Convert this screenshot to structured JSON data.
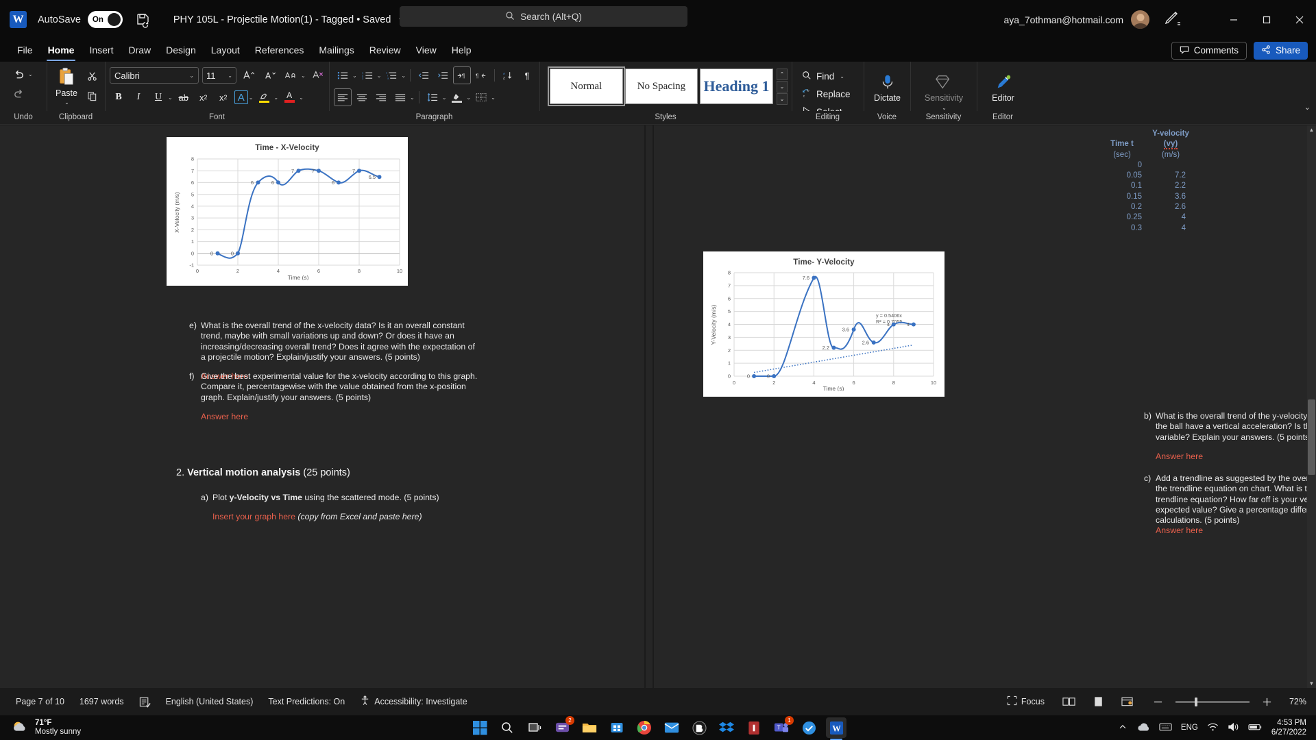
{
  "titlebar": {
    "app_logo": "W",
    "autosave_label": "AutoSave",
    "autosave_state": "On",
    "document_title": "PHY 105L - Projectile Motion(1) - Tagged • Saved",
    "search_placeholder": "Search (Alt+Q)",
    "account_email": "aya_7othman@hotmail.com"
  },
  "menu": {
    "tabs": [
      "File",
      "Home",
      "Insert",
      "Draw",
      "Design",
      "Layout",
      "References",
      "Mailings",
      "Review",
      "View",
      "Help"
    ],
    "active_tab": "Home",
    "comments_label": "Comments",
    "share_label": "Share"
  },
  "ribbon": {
    "groups": [
      "Undo",
      "Clipboard",
      "Font",
      "Paragraph",
      "Styles",
      "Editing",
      "Voice",
      "Sensitivity",
      "Editor"
    ],
    "paste_label": "Paste",
    "font_name": "Calibri",
    "font_size": "11",
    "styles": [
      {
        "label": "Normal",
        "kind": "normal",
        "selected": true
      },
      {
        "label": "No Spacing",
        "kind": "normal",
        "selected": false
      },
      {
        "label": "Heading 1",
        "kind": "h1",
        "selected": false
      }
    ],
    "editing": {
      "find_label": "Find",
      "replace_label": "Replace",
      "select_label": "Select"
    },
    "dictate_label": "Dictate",
    "sensitivity_label": "Sensitivity",
    "editor_label": "Editor"
  },
  "document": {
    "left_column": {
      "questions": [
        {
          "marker": "e)",
          "text": "What is the overall trend of the x-velocity data?  Is it an overall constant trend, maybe with small variations up and down? Or does it have an increasing/decreasing overall trend? Does it agree with the expectation of a projectile motion? Explain/justify your answers. (5 points)",
          "answer": "Answer here"
        },
        {
          "marker": "f)",
          "text": "Give the best experimental value for the x-velocity according to this graph.  Compare it, percentagewise with the value obtained from the x-position graph. Explain/justify your answers. (5 points)",
          "answer": "Answer here"
        }
      ],
      "section_number": "2.",
      "section_title": "Vertical motion analysis",
      "section_points": "(25 points)",
      "sub_a_marker": "a)",
      "sub_a_pre": "Plot ",
      "sub_a_bold": "y-Velocity vs Time",
      "sub_a_post": " using the scattered mode. (5 points)",
      "insert_graph_label": "Insert your graph here",
      "insert_graph_hint": "(copy from Excel and paste here)"
    },
    "right_column": {
      "table": {
        "header_col1_line1": "Time t",
        "header_col1_line2": "(sec)",
        "header_col2_line1": "Y-velocity",
        "header_col2_line2": "(vy)",
        "header_col2_line3": "(m/s)",
        "rows": [
          {
            "t": "0",
            "vy": ""
          },
          {
            "t": "0.05",
            "vy": "7.2"
          },
          {
            "t": "0.1",
            "vy": "2.2"
          },
          {
            "t": "0.15",
            "vy": "3.6"
          },
          {
            "t": "0.2",
            "vy": "2.6"
          },
          {
            "t": "0.25",
            "vy": "4"
          },
          {
            "t": "0.3",
            "vy": "4"
          }
        ]
      },
      "questions": [
        {
          "marker": "b)",
          "text": "What is the overall trend of the y-velocity data? Based on this graph, does the ball have a vertical acceleration? Is the acceleration constant or variable? Explain your answers. (5 points)",
          "answer": "Answer here"
        },
        {
          "marker": "c)",
          "text": "Add a trendline as suggested by the overall trend of the data points. Show the trendline equation on chart.  What is the y-acceleration as read off the trendline equation? How far off is your vertical acceleration from the expected value? Give a percentage difference. Explain your answers/show calculations. (5 points)",
          "answer": "Answer here"
        }
      ]
    }
  },
  "chart_data": [
    {
      "type": "line",
      "title": "Time - X-Velocity",
      "xlabel": "Time (s)",
      "ylabel": "X-Velocity (m/s)",
      "xlim": [
        0,
        10
      ],
      "ylim": [
        -1,
        8
      ],
      "xticks": [
        0,
        2,
        4,
        6,
        8,
        10
      ],
      "yticks": [
        -1,
        0,
        1,
        2,
        3,
        4,
        5,
        6,
        7,
        8
      ],
      "grid": true,
      "legend": "none",
      "series_color": "#3a72c2",
      "x": [
        1,
        2,
        3,
        4,
        5,
        6,
        7,
        8,
        9
      ],
      "values": [
        0,
        0,
        6,
        6,
        7,
        7,
        6,
        7,
        6.5
      ],
      "point_labels": [
        "0",
        "0",
        "6",
        "6",
        "7",
        "7",
        "6",
        "7",
        "6.5"
      ]
    },
    {
      "type": "line",
      "title": "Time- Y-Velocity",
      "xlabel": "Time (s)",
      "ylabel": "Y-Velocity (m/s)",
      "xlim": [
        0,
        10
      ],
      "ylim": [
        0,
        8
      ],
      "xticks": [
        0,
        2,
        4,
        6,
        8,
        10
      ],
      "yticks": [
        0,
        1,
        2,
        3,
        4,
        5,
        6,
        7,
        8
      ],
      "grid": true,
      "legend": "none",
      "series_color": "#3a72c2",
      "x": [
        1,
        2,
        4,
        5,
        6,
        7,
        8,
        9
      ],
      "values": [
        0,
        0,
        7.6,
        2.2,
        3.6,
        2.6,
        4,
        4
      ],
      "point_labels": [
        "0",
        "0",
        "7.6",
        "2.2",
        "3.6",
        "2.6",
        "4",
        "4"
      ],
      "trendline": {
        "equation": "y = 0.5406x",
        "r_squared": "R² = 0.7055",
        "slope": 0.5406,
        "intercept": 0,
        "style": "dotted"
      }
    }
  ],
  "statusbar": {
    "page_label": "Page 7 of 10",
    "word_count": "1697 words",
    "language": "English (United States)",
    "text_predictions": "Text Predictions: On",
    "accessibility": "Accessibility: Investigate",
    "focus_label": "Focus",
    "zoom_level": "72%"
  },
  "taskbar": {
    "temperature": "71°F",
    "condition": "Mostly sunny",
    "language_indicator": "ENG",
    "time": "4:53 PM",
    "date": "6/27/2022",
    "teams_badge": "2"
  }
}
